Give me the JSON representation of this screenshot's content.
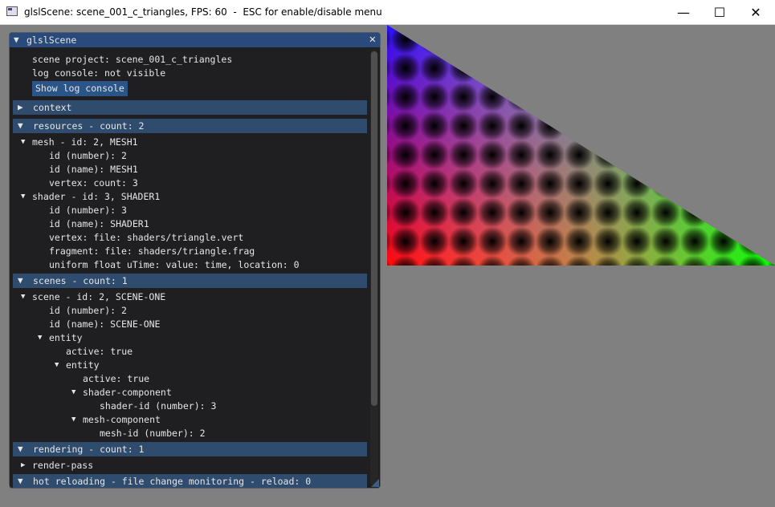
{
  "window": {
    "title": "glslScene: scene_001_c_triangles, FPS: 60  -  ESC for enable/disable menu",
    "minimize": "—",
    "maximize": "☐",
    "close": "✕"
  },
  "panel": {
    "title": "glslScene",
    "collapse_glyph": "▼",
    "close_glyph": "✕",
    "scene_project": "scene project: scene_001_c_triangles",
    "log_console": "log console: not visible",
    "show_log_button": "Show log console",
    "headers": {
      "context": "context",
      "resources": "resources - count: 2",
      "scenes": "scenes - count: 1",
      "rendering": "rendering - count: 1",
      "hot_reloading": "hot reloading - file change monitoring - reload: 0"
    },
    "glyph_open": "▼",
    "glyph_closed": "▶",
    "small_open": "▼",
    "small_closed": "▶",
    "resources": {
      "mesh": "mesh - id: 2, MESH1",
      "mesh_id_number": "id (number): 2",
      "mesh_id_name": "id (name): MESH1",
      "mesh_vertex": "vertex: count: 3",
      "shader": "shader - id: 3, SHADER1",
      "shader_id_number": "id (number): 3",
      "shader_id_name": "id (name): SHADER1",
      "shader_vertex": "vertex: file: shaders/triangle.vert",
      "shader_fragment": "fragment: file: shaders/triangle.frag",
      "shader_uniform": "uniform float uTime: value: time, location: 0"
    },
    "scenes": {
      "scene": "scene - id: 2, SCENE-ONE",
      "scene_id_number": "id (number): 2",
      "scene_id_name": "id (name): SCENE-ONE",
      "entity1": "entity",
      "entity1_active": "active: true",
      "entity2": "entity",
      "entity2_active": "active: true",
      "shader_component": "shader-component",
      "shader_component_id": "shader-id (number): 3",
      "mesh_component": "mesh-component",
      "mesh_component_id": "mesh-id (number): 2"
    },
    "rendering": {
      "render_pass": "render-pass"
    }
  }
}
